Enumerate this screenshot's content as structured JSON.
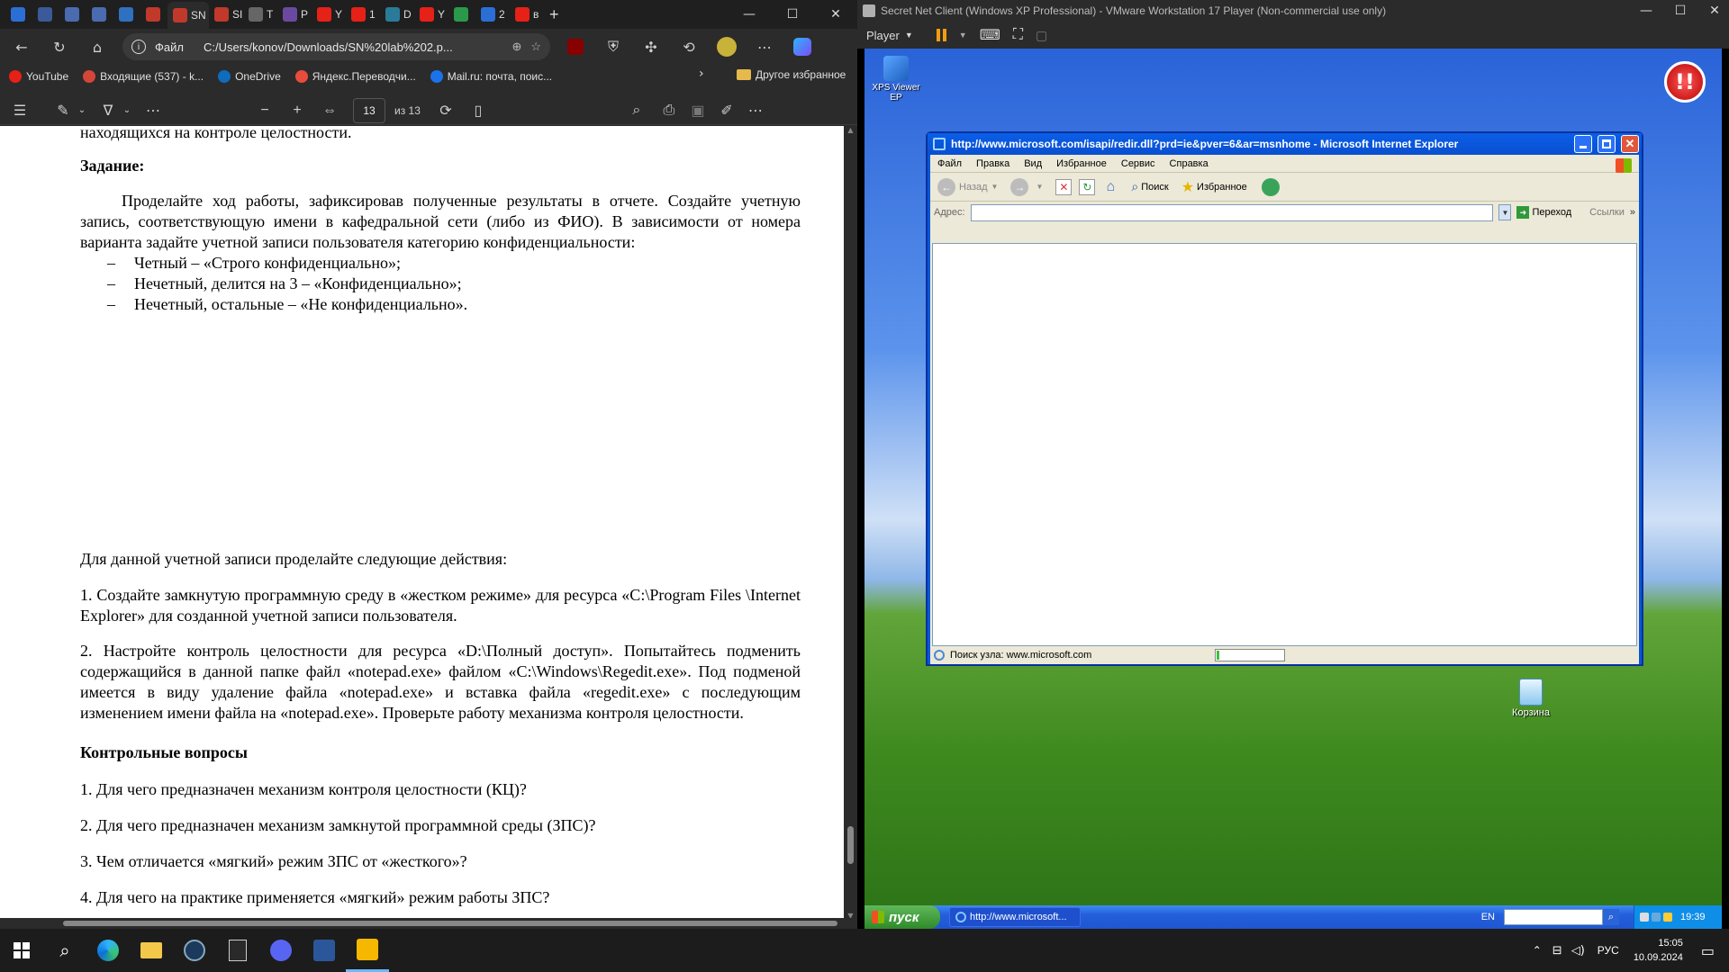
{
  "edge": {
    "tabs": [
      {
        "label": "",
        "color": "#2b6fd6"
      },
      {
        "label": "",
        "color": "#3a5a9a"
      },
      {
        "label": "",
        "color": "#4a6bb0"
      },
      {
        "label": "",
        "color": "#4a6bb0"
      },
      {
        "label": "",
        "color": "#3070c0"
      },
      {
        "label": "",
        "color": "#c0392b"
      },
      {
        "label": "SN",
        "color": "#c0392b",
        "active": true
      },
      {
        "label": "SI",
        "color": "#c0392b"
      },
      {
        "label": "T",
        "color": "#666"
      },
      {
        "label": "P",
        "color": "#6a4aa0"
      },
      {
        "label": "Y",
        "color": "#e62117"
      },
      {
        "label": "1",
        "color": "#e62117"
      },
      {
        "label": "D",
        "color": "#2a7a9a"
      },
      {
        "label": "Y",
        "color": "#e62117"
      },
      {
        "label": "",
        "color": "#2a9a4a"
      },
      {
        "label": "2",
        "color": "#2b6fd6"
      },
      {
        "label": "в",
        "color": "#e62117"
      }
    ],
    "window_buttons": {
      "minimize": "—",
      "maximize": "☐",
      "close": "✕"
    },
    "address": {
      "info_label": "Файл",
      "url": "C:/Users/konov/Downloads/SN%20lab%202.p..."
    },
    "bookmarks": [
      {
        "label": "YouTube",
        "color": "#e62117"
      },
      {
        "label": "Входящие (537) - k...",
        "color": "#d44638"
      },
      {
        "label": "OneDrive",
        "color": "#0f6cbd"
      },
      {
        "label": "Яндекс.Переводчи...",
        "color": "#e74c3c"
      },
      {
        "label": "Mail.ru: почта, поис...",
        "color": "#1a73e8"
      }
    ],
    "other_bookmarks": "Другое избранное",
    "pdf": {
      "page_number": "13",
      "page_total": "из 13"
    }
  },
  "document": {
    "top_fragment": "находящихся на контроле целостности.",
    "task_heading": "Задание:",
    "task_text": "Проделайте ход работы, зафиксировав полученные результаты в отчете. Создайте учетную запись, соответствующую имени в кафедральной сети (либо из ФИО). В зависимости от номера варианта задайте учетной записи пользователя категорию конфиденциальности:",
    "bullets": [
      "Четный – «Строго конфиденциально»;",
      "Нечетный, делится на 3 – «Конфиденциально»;",
      "Нечетный, остальные – «Не конфиденциально»."
    ],
    "intro": "Для данной учетной записи проделайте следующие действия:",
    "step1": "1. Создайте замкнутую программную среду в «жестком режиме» для ресурса «C:\\Program Files \\Internet Explorer» для созданной учетной записи пользователя.",
    "step2": "2. Настройте контроль целостности для ресурса «D:\\Полный доступ». Попытайтесь подменить содержащийся в данной папке файл «notepad.exe» файлом «C:\\Windows\\Regedit.exe». Под подменой имеется в виду удаление файла «notepad.exe» и вставка файла «regedit.exe» с последующим изменением имени файла на «notepad.exe». Проверьте работу механизма контроля целостности.",
    "questions_heading": "Контрольные вопросы",
    "questions": [
      "1. Для чего предназначен механизм контроля целостности (КЦ)?",
      "2. Для чего предназначен механизм замкнутой программной среды (ЗПС)?",
      "3. Чем отличается «мягкий» режим ЗПС от «жесткого»?",
      "4. Для чего на практике применяется «мягкий» режим работы ЗПС?"
    ]
  },
  "vmware": {
    "title": "Secret Net Client (Windows XP Professional) - VMware Workstation 17 Player (Non-commercial use only)",
    "player_menu": "Player",
    "window_buttons": {
      "minimize": "—",
      "maximize": "☐",
      "close": "✕"
    }
  },
  "xp": {
    "desktop_icons": {
      "xps": "XPS Viewer EP",
      "recycle": "Корзина"
    },
    "ie": {
      "title": "http://www.microsoft.com/isapi/redir.dll?prd=ie&pver=6&ar=msnhome - Microsoft Internet Explorer",
      "menu": [
        "Файл",
        "Правка",
        "Вид",
        "Избранное",
        "Сервис",
        "Справка"
      ],
      "back": "Назад",
      "search": "Поиск",
      "favorites": "Избранное",
      "address_label": "Адрес:",
      "go": "Переход",
      "links": "Ссылки",
      "status": "Поиск узла: www.microsoft.com",
      "progress": 0.04
    },
    "taskbar": {
      "start": "пуск",
      "task": "http://www.microsoft...",
      "lang": "EN",
      "time": "19:39"
    }
  },
  "windows": {
    "lang": "РУС",
    "time": "15:05",
    "date": "10.09.2024"
  }
}
